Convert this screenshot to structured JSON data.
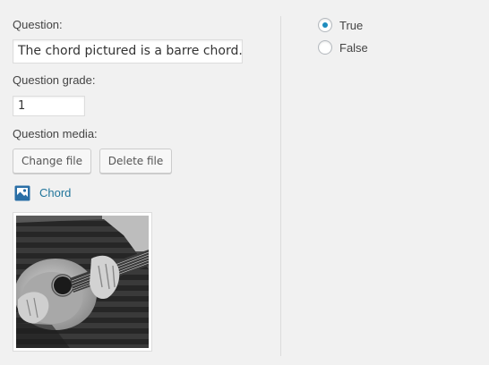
{
  "question": {
    "label": "Question:",
    "value": "The chord pictured is a barre chord."
  },
  "grade": {
    "label": "Question grade:",
    "value": "1"
  },
  "media": {
    "label": "Question media:",
    "change_button": "Change file",
    "delete_button": "Delete file",
    "file_icon": "image-file-icon",
    "file_name": "Chord",
    "thumbnail": "guitar-player-photo"
  },
  "answers": {
    "options": [
      {
        "label": "True",
        "checked": true
      },
      {
        "label": "False",
        "checked": false
      }
    ],
    "accent_color": "#1e8cbe"
  },
  "colors": {
    "background": "#f1f1f1",
    "link": "#21759b",
    "icon": "#2a6fa6"
  }
}
